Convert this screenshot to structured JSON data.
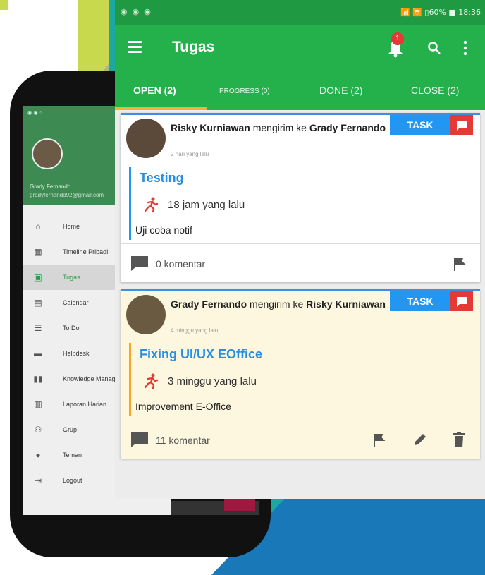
{
  "colors": {
    "primary": "#24b04b",
    "primary_dark": "#1f9a42",
    "accent": "#f2b234",
    "task_blue": "#2196f3",
    "task_red": "#e53935",
    "drawer_green": "#3d8a52"
  },
  "statusbar": {
    "left_icons": "◉ ◉ ◉",
    "right_text": "📶 🛜 ▯60% ■ 18:36"
  },
  "app": {
    "title": "Tugas",
    "notification_count": "1"
  },
  "tabs": [
    {
      "label": "OPEN (2)",
      "active": true
    },
    {
      "label": "PROGRESS (0)",
      "active": false
    },
    {
      "label": "DONE (2)",
      "active": false
    },
    {
      "label": "CLOSE (2)",
      "active": false
    }
  ],
  "cards": [
    {
      "sender": "Risky Kurniawan",
      "verb": " mengirim ke ",
      "recipient": "Grady Fernando",
      "time": "2 hari yang lalu",
      "badge": "TASK",
      "title": "Testing",
      "age": "18 jam yang lalu",
      "description": "Uji coba notif",
      "comments": "0 komentar"
    },
    {
      "sender": "Grady Fernando",
      "verb": " mengirim ke ",
      "recipient": "Risky Kurniawan",
      "time": "4 minggu yang lalu",
      "badge": "TASK",
      "title": "Fixing UI/UX EOffice",
      "age": "3 minggu yang lalu",
      "description": "Improvement E-Office",
      "comments": "11 komentar"
    }
  ],
  "drawer": {
    "status": "◉ ◉ ◦",
    "user_name": "Grady Fernando",
    "user_email": "gradyfernando92@gmail.com",
    "items": [
      {
        "label": "Home",
        "icon": "home-icon",
        "active": false
      },
      {
        "label": "Timeline Pribadi",
        "icon": "timeline-icon",
        "active": false
      },
      {
        "label": "Tugas",
        "icon": "clipboard-icon",
        "active": true
      },
      {
        "label": "Calendar",
        "icon": "calendar-icon",
        "active": false
      },
      {
        "label": "To Do",
        "icon": "checklist-icon",
        "active": false
      },
      {
        "label": "Helpdesk",
        "icon": "chat-icon",
        "active": false
      },
      {
        "label": "Knowledge Management",
        "icon": "book-icon",
        "active": false
      },
      {
        "label": "Laporan Harian",
        "icon": "report-icon",
        "active": false
      },
      {
        "label": "Grup",
        "icon": "group-icon",
        "active": false
      },
      {
        "label": "Teman",
        "icon": "person-icon",
        "active": false
      },
      {
        "label": "Logout",
        "icon": "logout-icon",
        "active": false
      }
    ]
  }
}
